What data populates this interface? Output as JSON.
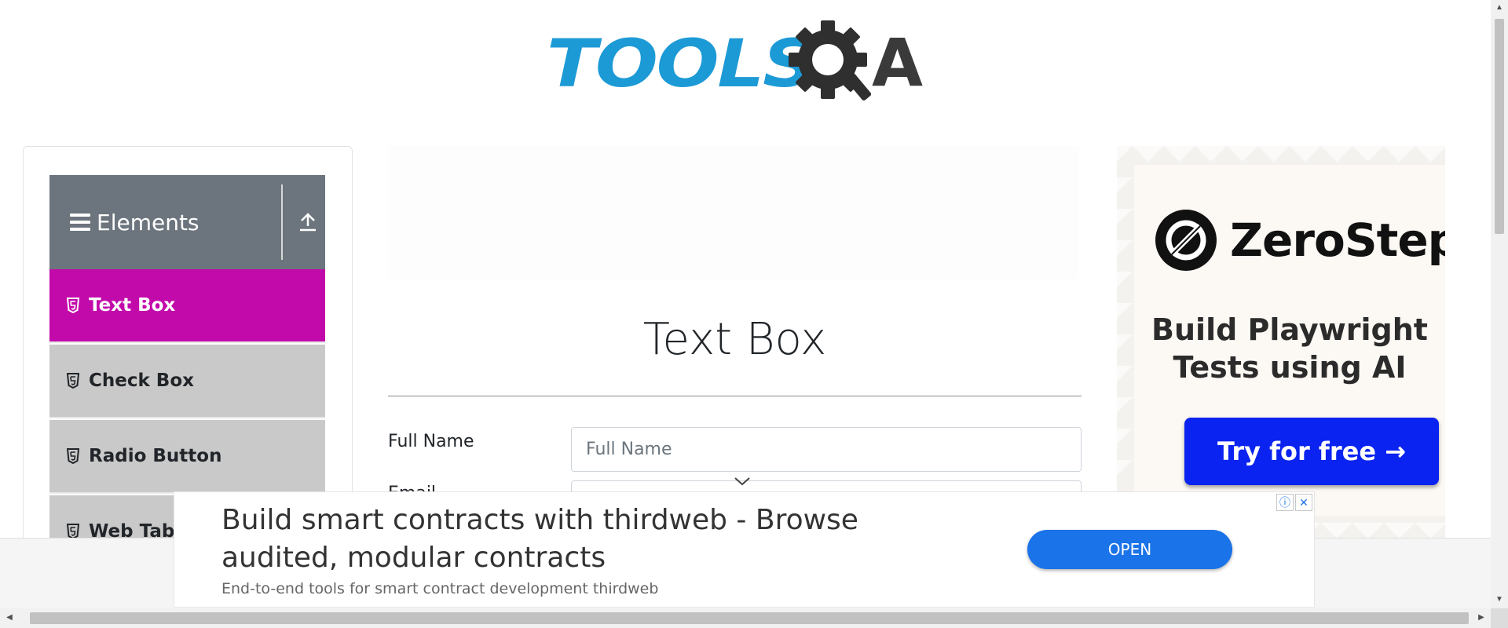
{
  "header": {
    "logo_text_left": "TOOLS",
    "logo_text_right": "A"
  },
  "sidebar": {
    "group_title": "Elements",
    "items": [
      {
        "label": "Text Box",
        "active": true
      },
      {
        "label": "Check Box",
        "active": false
      },
      {
        "label": "Radio Button",
        "active": false
      },
      {
        "label": "Web Tables",
        "active": false
      }
    ]
  },
  "main": {
    "title": "Text Box",
    "fields": [
      {
        "label": "Full Name",
        "placeholder": "Full Name"
      },
      {
        "label": "Email",
        "placeholder": ""
      }
    ]
  },
  "right_ad": {
    "brand": "ZeroStep",
    "tagline": "Build Playwright Tests using AI",
    "cta": "Try for free →",
    "brand_color": "#0a23f0"
  },
  "bottom_ad": {
    "headline": "Build smart contracts with thirdweb - Browse audited, modular contracts",
    "subtext": "End-to-end tools for smart contract development thirdweb",
    "open_label": "OPEN",
    "accent": "#1a73e8"
  },
  "colors": {
    "active_item": "#c20aab",
    "group_header": "#6c757d",
    "inactive_item": "#c9c9c9",
    "logo_blue": "#1c9ad6"
  }
}
